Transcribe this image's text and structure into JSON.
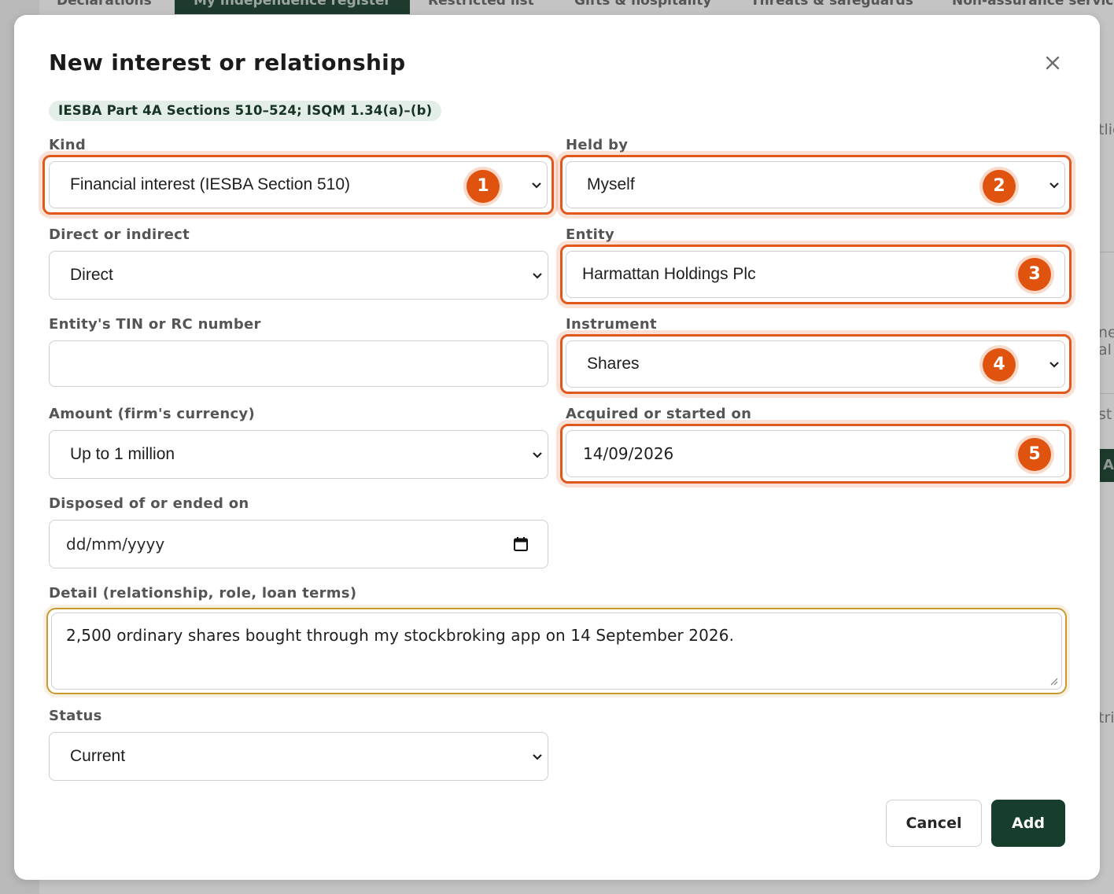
{
  "background": {
    "tabs": [
      {
        "label": "Declarations"
      },
      {
        "label": "My independence register"
      },
      {
        "label": "Restricted list"
      },
      {
        "label": "Gifts & hospitality"
      },
      {
        "label": "Threats & safeguards"
      },
      {
        "label": "Non-assurance servic"
      }
    ],
    "side_fragments": [
      "tlie",
      "ne",
      "al",
      "st",
      "tri"
    ],
    "side_button_label": "A"
  },
  "modal": {
    "title": "New interest or relationship",
    "close_icon": "close-icon",
    "reference_badge": "IESBA Part 4A Sections 510–524; ISQM 1.34(a)–(b)",
    "fields": {
      "kind": {
        "label": "Kind",
        "value": "Financial interest (IESBA Section 510)",
        "marker": "1"
      },
      "held_by": {
        "label": "Held by",
        "value": "Myself",
        "marker": "2"
      },
      "direct_or_indirect": {
        "label": "Direct or indirect",
        "value": "Direct"
      },
      "entity": {
        "label": "Entity",
        "value": "Harmattan Holdings Plc",
        "marker": "3"
      },
      "tin_rc": {
        "label": "Entity's TIN or RC number",
        "value": ""
      },
      "instrument": {
        "label": "Instrument",
        "value": "Shares",
        "marker": "4"
      },
      "amount": {
        "label": "Amount (firm's currency)",
        "value": "Up to 1 million"
      },
      "acquired_on": {
        "label": "Acquired or started on",
        "value": "14/09/2026",
        "marker": "5"
      },
      "disposed_on": {
        "label": "Disposed of or ended on",
        "placeholder": "dd/mm/yyyy"
      },
      "detail": {
        "label": "Detail (relationship, role, loan terms)",
        "value": "2,500 ordinary shares bought through my stockbroking app on 14 September 2026."
      },
      "status": {
        "label": "Status",
        "value": "Current"
      }
    },
    "buttons": {
      "cancel": "Cancel",
      "add": "Add"
    }
  },
  "colors": {
    "accent_dark_green": "#173d2d",
    "highlight_orange": "#e0581c",
    "focus_gold": "#c89a2e",
    "badge_bg": "#e3efe6"
  }
}
